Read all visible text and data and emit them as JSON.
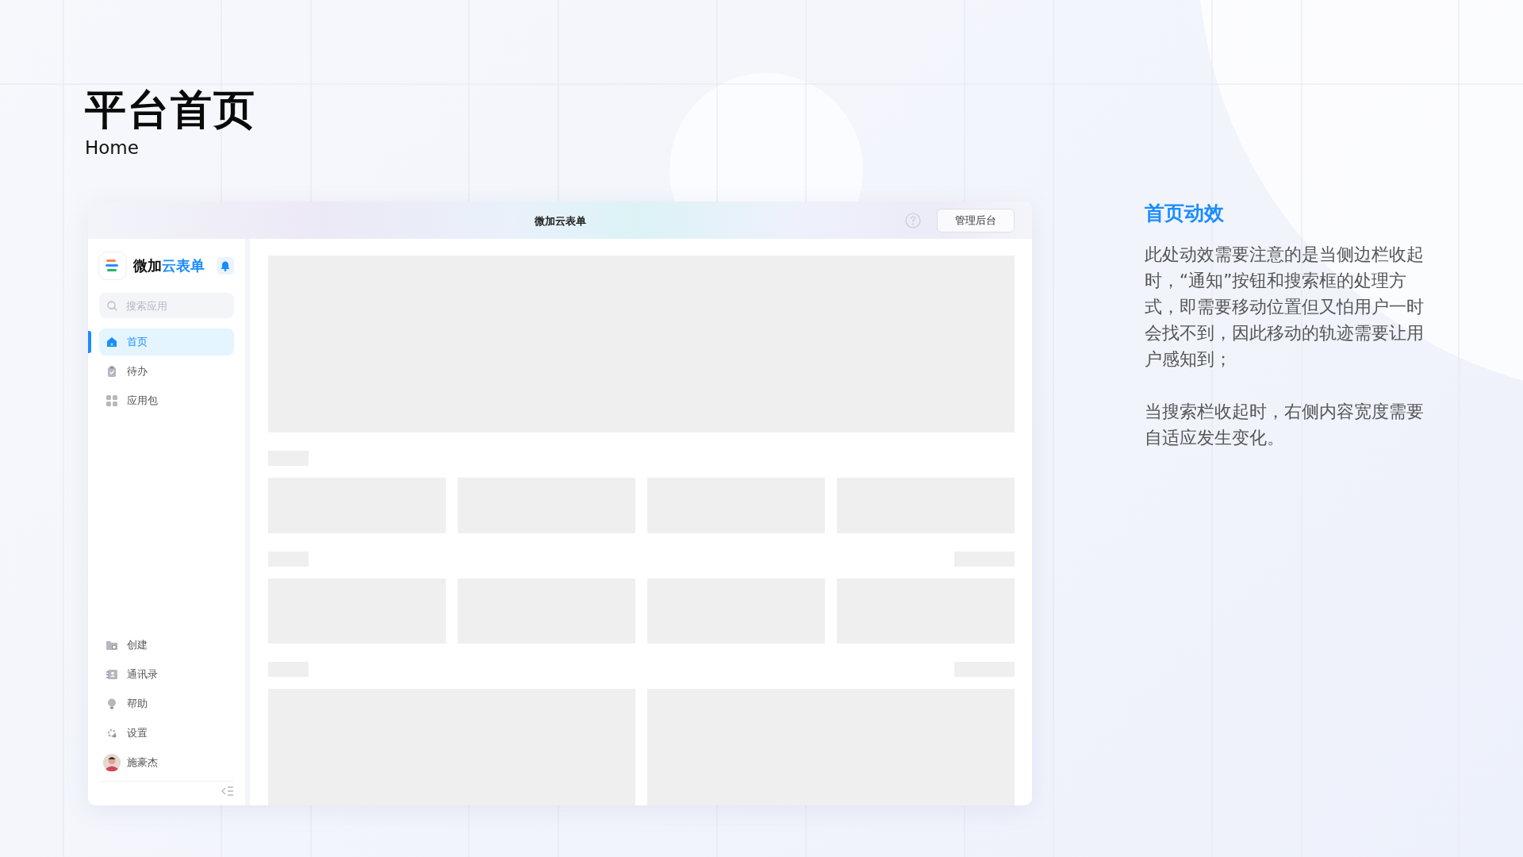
{
  "heading": {
    "title": "平台首页",
    "subtitle": "Home"
  },
  "app": {
    "window_title": "微加云表单",
    "admin_button": "管理后台",
    "brand": {
      "prefix": "微加",
      "suffix": "云表单"
    },
    "search": {
      "placeholder": "搜索应用"
    },
    "nav": [
      {
        "label": "首页",
        "kind": "home",
        "selected": true
      },
      {
        "label": "待办",
        "kind": "todo",
        "selected": false
      },
      {
        "label": "应用包",
        "kind": "apps",
        "selected": false
      }
    ],
    "bottom_nav": [
      {
        "label": "创建",
        "kind": "create",
        "selected": false
      },
      {
        "label": "通讯录",
        "kind": "contacts",
        "selected": false
      },
      {
        "label": "帮助",
        "kind": "help",
        "selected": false
      },
      {
        "label": "设置",
        "kind": "settings",
        "selected": false
      },
      {
        "label": "施豪杰",
        "kind": "user",
        "selected": false
      }
    ]
  },
  "notes": {
    "title": "首页动效",
    "paragraphs": [
      "此处动效需要注意的是当侧边栏收起时，“通知”按钮和搜索框的处理方式，即需要移动位置但又怕用户一时会找不到，因此移动的轨迹需要让用户感知到；",
      "当搜索栏收起时，右侧内容宽度需要自适应发生变化。"
    ]
  }
}
